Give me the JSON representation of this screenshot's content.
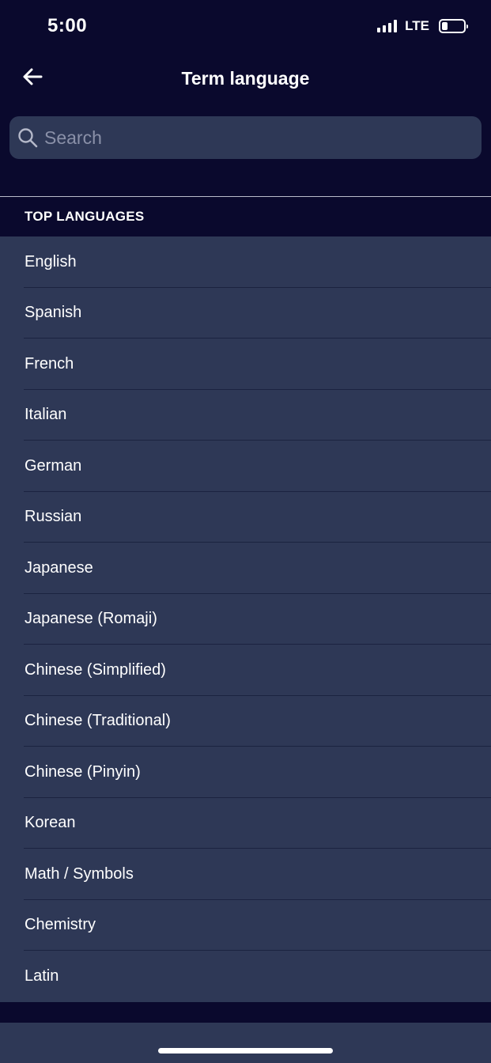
{
  "status_bar": {
    "time": "5:00",
    "network": "LTE"
  },
  "header": {
    "title": "Term language"
  },
  "search": {
    "placeholder": "Search"
  },
  "section": {
    "title": "TOP LANGUAGES"
  },
  "languages": [
    "English",
    "Spanish",
    "French",
    "Italian",
    "German",
    "Russian",
    "Japanese",
    "Japanese (Romaji)",
    "Chinese (Simplified)",
    "Chinese (Traditional)",
    "Chinese (Pinyin)",
    "Korean",
    "Math / Symbols",
    "Chemistry",
    "Latin"
  ],
  "icons": {
    "back": "arrow-left-icon",
    "search": "search-icon",
    "signal": "signal-icon",
    "battery": "battery-icon"
  },
  "colors": {
    "background": "#0a092d",
    "surface": "#2e3856",
    "text": "#ffffff",
    "placeholder": "#8a90a8"
  }
}
